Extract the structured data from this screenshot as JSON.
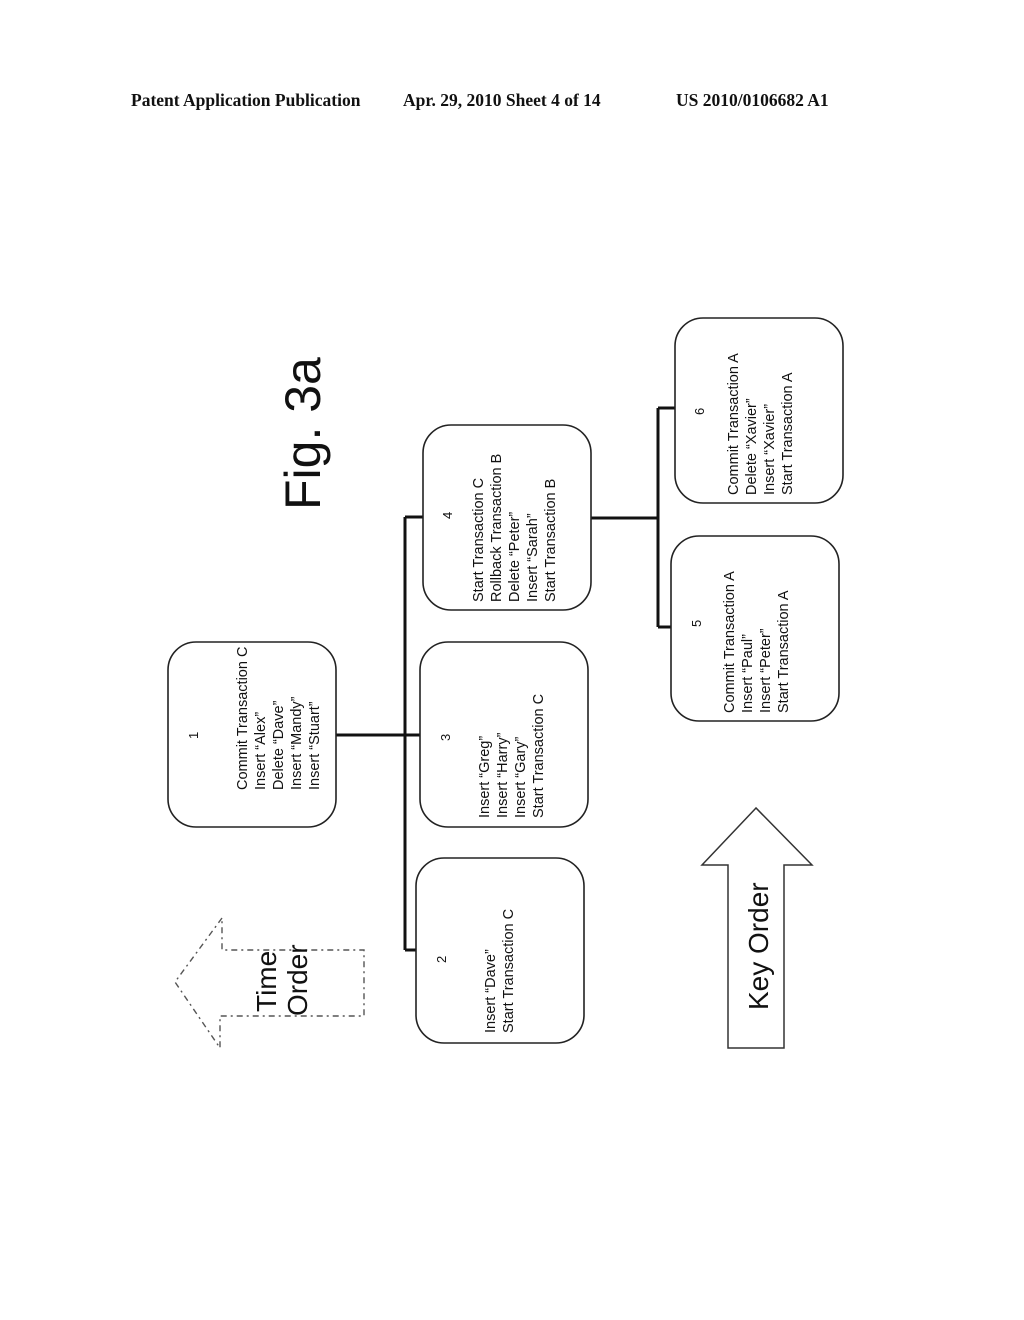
{
  "header": {
    "left": "Patent Application Publication",
    "middle": "Apr. 29, 2010  Sheet 4 of 14",
    "right": "US 2010/0106682 A1"
  },
  "figure": {
    "title": "Fig. 3a",
    "orientation": "rotated 90 degrees counter-clockwise",
    "nodes": [
      {
        "id": "1",
        "number": "1",
        "lines": [
          "Commit Transaction C",
          "Insert “Alex”",
          "Delete “Dave”",
          "Insert “Mandy”",
          "Insert “Stuart”"
        ]
      },
      {
        "id": "2",
        "number": "2",
        "lines": [
          "Insert “Dave”",
          "Start Transaction C"
        ]
      },
      {
        "id": "3",
        "number": "3",
        "lines": [
          "Insert “Greg”",
          "Insert “Harry”",
          "Insert “Gary”",
          "Start Transaction C"
        ]
      },
      {
        "id": "4",
        "number": "4",
        "lines": [
          "Start Transaction C",
          "Rollback Transaction B",
          "Delete “Peter”",
          "Insert “Sarah”",
          "Start Transaction B"
        ]
      },
      {
        "id": "5",
        "number": "5",
        "lines": [
          "Commit Transaction A",
          "Insert “Paul”",
          "Insert “Peter”",
          "Start Transaction A"
        ]
      },
      {
        "id": "6",
        "number": "6",
        "lines": [
          "Commit Transaction  A",
          "Delete “Xavier”",
          "Insert “Xavier”",
          "Start Transaction A"
        ]
      }
    ],
    "edges": [
      {
        "from": "1",
        "to": "2"
      },
      {
        "from": "1",
        "to": "3"
      },
      {
        "from": "1",
        "to": "4"
      },
      {
        "from": "4",
        "to": "5"
      },
      {
        "from": "4",
        "to": "6"
      }
    ],
    "arrows": {
      "time_order": {
        "line1": "Time",
        "line2": "Order",
        "style": "dashed"
      },
      "key_order": {
        "label": "Key Order",
        "style": "solid"
      }
    }
  }
}
